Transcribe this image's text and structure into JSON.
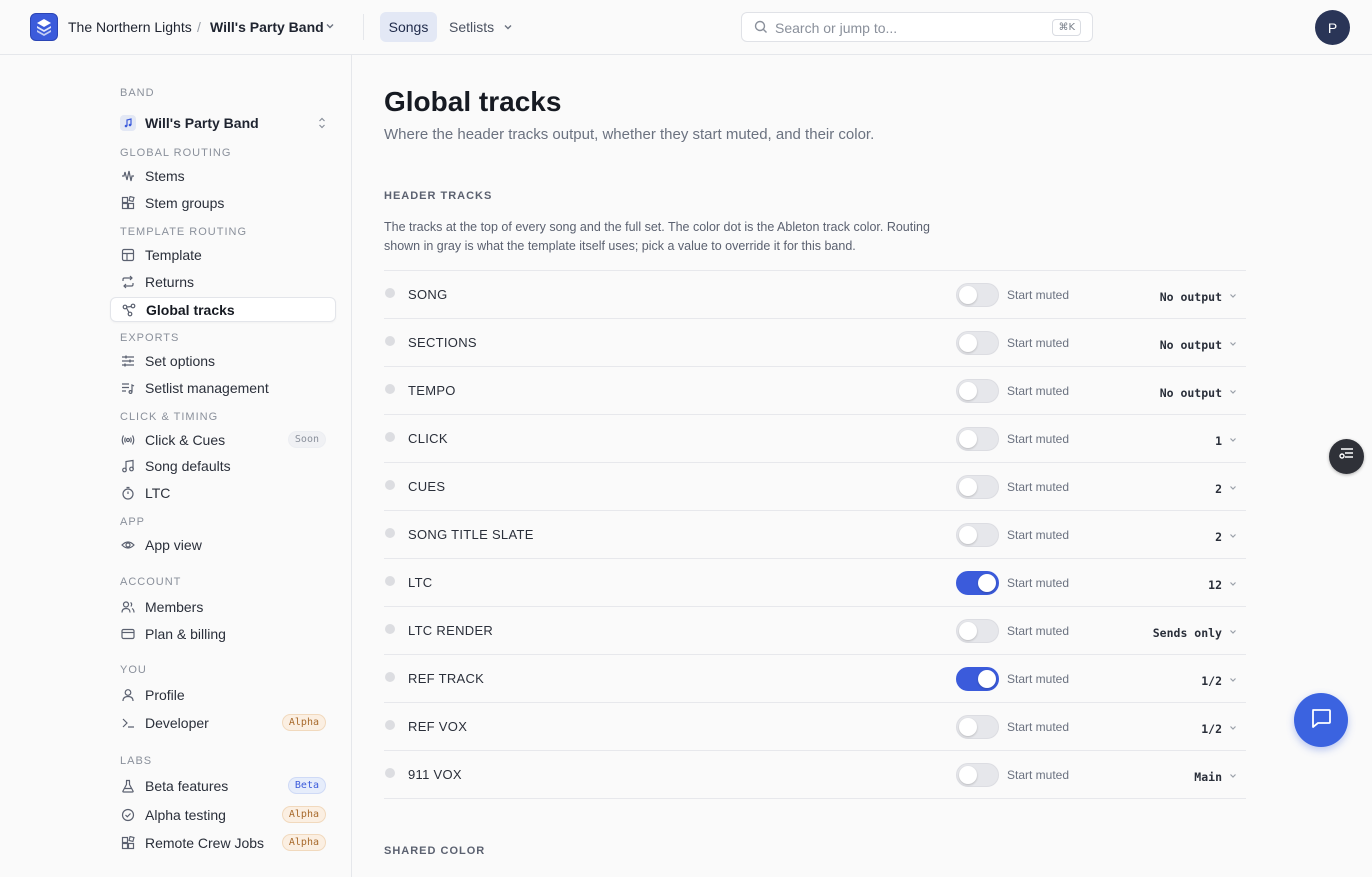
{
  "topbar": {
    "org": "The Northern Lights",
    "separator": "/",
    "band": "Will's Party Band",
    "tabs": {
      "songs": "Songs",
      "setlists": "Setlists"
    },
    "search_placeholder": "Search or jump to...",
    "search_shortcut": "⌘K",
    "avatar_initial": "P"
  },
  "sidebar": {
    "band_label": "BAND",
    "band_name": "Will's Party Band",
    "sections": {
      "global_routing": "GLOBAL ROUTING",
      "template_routing": "TEMPLATE ROUTING",
      "exports": "EXPORTS",
      "click_timing": "CLICK & TIMING",
      "app": "APP",
      "account": "ACCOUNT",
      "you": "YOU",
      "labs": "LABS"
    },
    "items": {
      "stems": "Stems",
      "stem_groups": "Stem groups",
      "template": "Template",
      "returns": "Returns",
      "global_tracks": "Global tracks",
      "set_options": "Set options",
      "setlist_management": "Setlist management",
      "click_cues": "Click & Cues",
      "song_defaults": "Song defaults",
      "ltc": "LTC",
      "app_view": "App view",
      "members": "Members",
      "plan_billing": "Plan & billing",
      "profile": "Profile",
      "developer": "Developer",
      "beta_features": "Beta features",
      "alpha_testing": "Alpha testing",
      "remote_crew_jobs": "Remote Crew Jobs"
    },
    "badges": {
      "soon": "Soon",
      "alpha": "Alpha",
      "beta": "Beta"
    },
    "active_item": "global_tracks"
  },
  "main": {
    "title": "Global tracks",
    "subtitle": "Where the header tracks output, whether they start muted, and their color.",
    "header_tracks_label": "HEADER TRACKS",
    "header_tracks_desc": "The tracks at the top of every song and the full set. The color dot is the Ableton track color. Routing shown in gray is what the template itself uses; pick a value to override it for this band.",
    "start_muted_label": "Start muted",
    "tracks": [
      {
        "name": "SONG",
        "muted": false,
        "output": "No output"
      },
      {
        "name": "SECTIONS",
        "muted": false,
        "output": "No output"
      },
      {
        "name": "TEMPO",
        "muted": false,
        "output": "No output"
      },
      {
        "name": "CLICK",
        "muted": false,
        "output": "1"
      },
      {
        "name": "CUES",
        "muted": false,
        "output": "2"
      },
      {
        "name": "SONG TITLE SLATE",
        "muted": false,
        "output": "2"
      },
      {
        "name": "LTC",
        "muted": true,
        "output": "12"
      },
      {
        "name": "LTC RENDER",
        "muted": false,
        "output": "Sends only"
      },
      {
        "name": "REF TRACK",
        "muted": true,
        "output": "1/2"
      },
      {
        "name": "REF VOX",
        "muted": false,
        "output": "1/2"
      },
      {
        "name": "911 VOX",
        "muted": false,
        "output": "Main"
      }
    ],
    "shared_color_label": "SHARED COLOR"
  },
  "colors": {
    "accent": "#3b5bdb",
    "avatar": "#2a3557",
    "chat_button": "#3b63e0"
  }
}
